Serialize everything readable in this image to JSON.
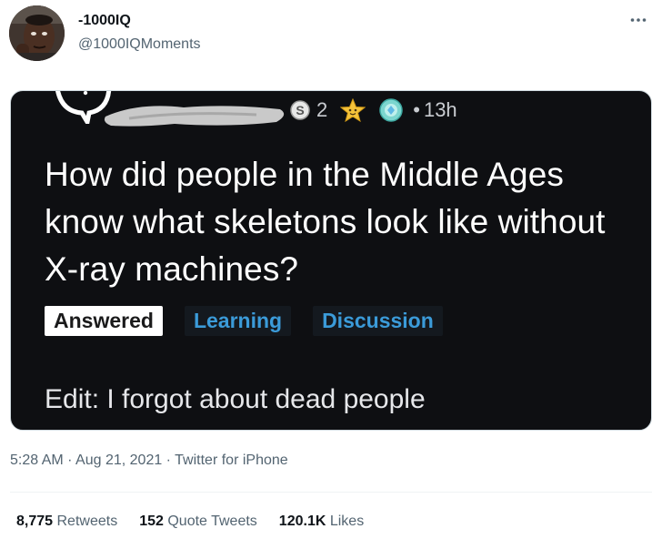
{
  "author": {
    "display_name": "-1000IQ",
    "handle": "@1000IQMoments"
  },
  "media": {
    "meta": {
      "silver_count": "2",
      "time": "13h",
      "separator": "•"
    },
    "question": "How did people in the Middle Ages know what skeletons look like without X-ray machines?",
    "flairs": [
      "Answered",
      "Learning",
      "Discussion"
    ],
    "edit": "Edit: I forgot about dead people",
    "colors": {
      "background": "#0e0f12",
      "flair_blue": "#3b9bd9"
    }
  },
  "footer": {
    "timestamp": "5:28 AM · Aug 21, 2021 · Twitter for iPhone",
    "retweets": {
      "count": "8,775",
      "label": "Retweets"
    },
    "quotes": {
      "count": "152",
      "label": "Quote Tweets"
    },
    "likes": {
      "count": "120.1K",
      "label": "Likes"
    }
  },
  "icons": [
    "more-dots-icon",
    "speech-bubble-icon",
    "silver-award-icon",
    "star-award-icon",
    "diamond-award-icon"
  ]
}
